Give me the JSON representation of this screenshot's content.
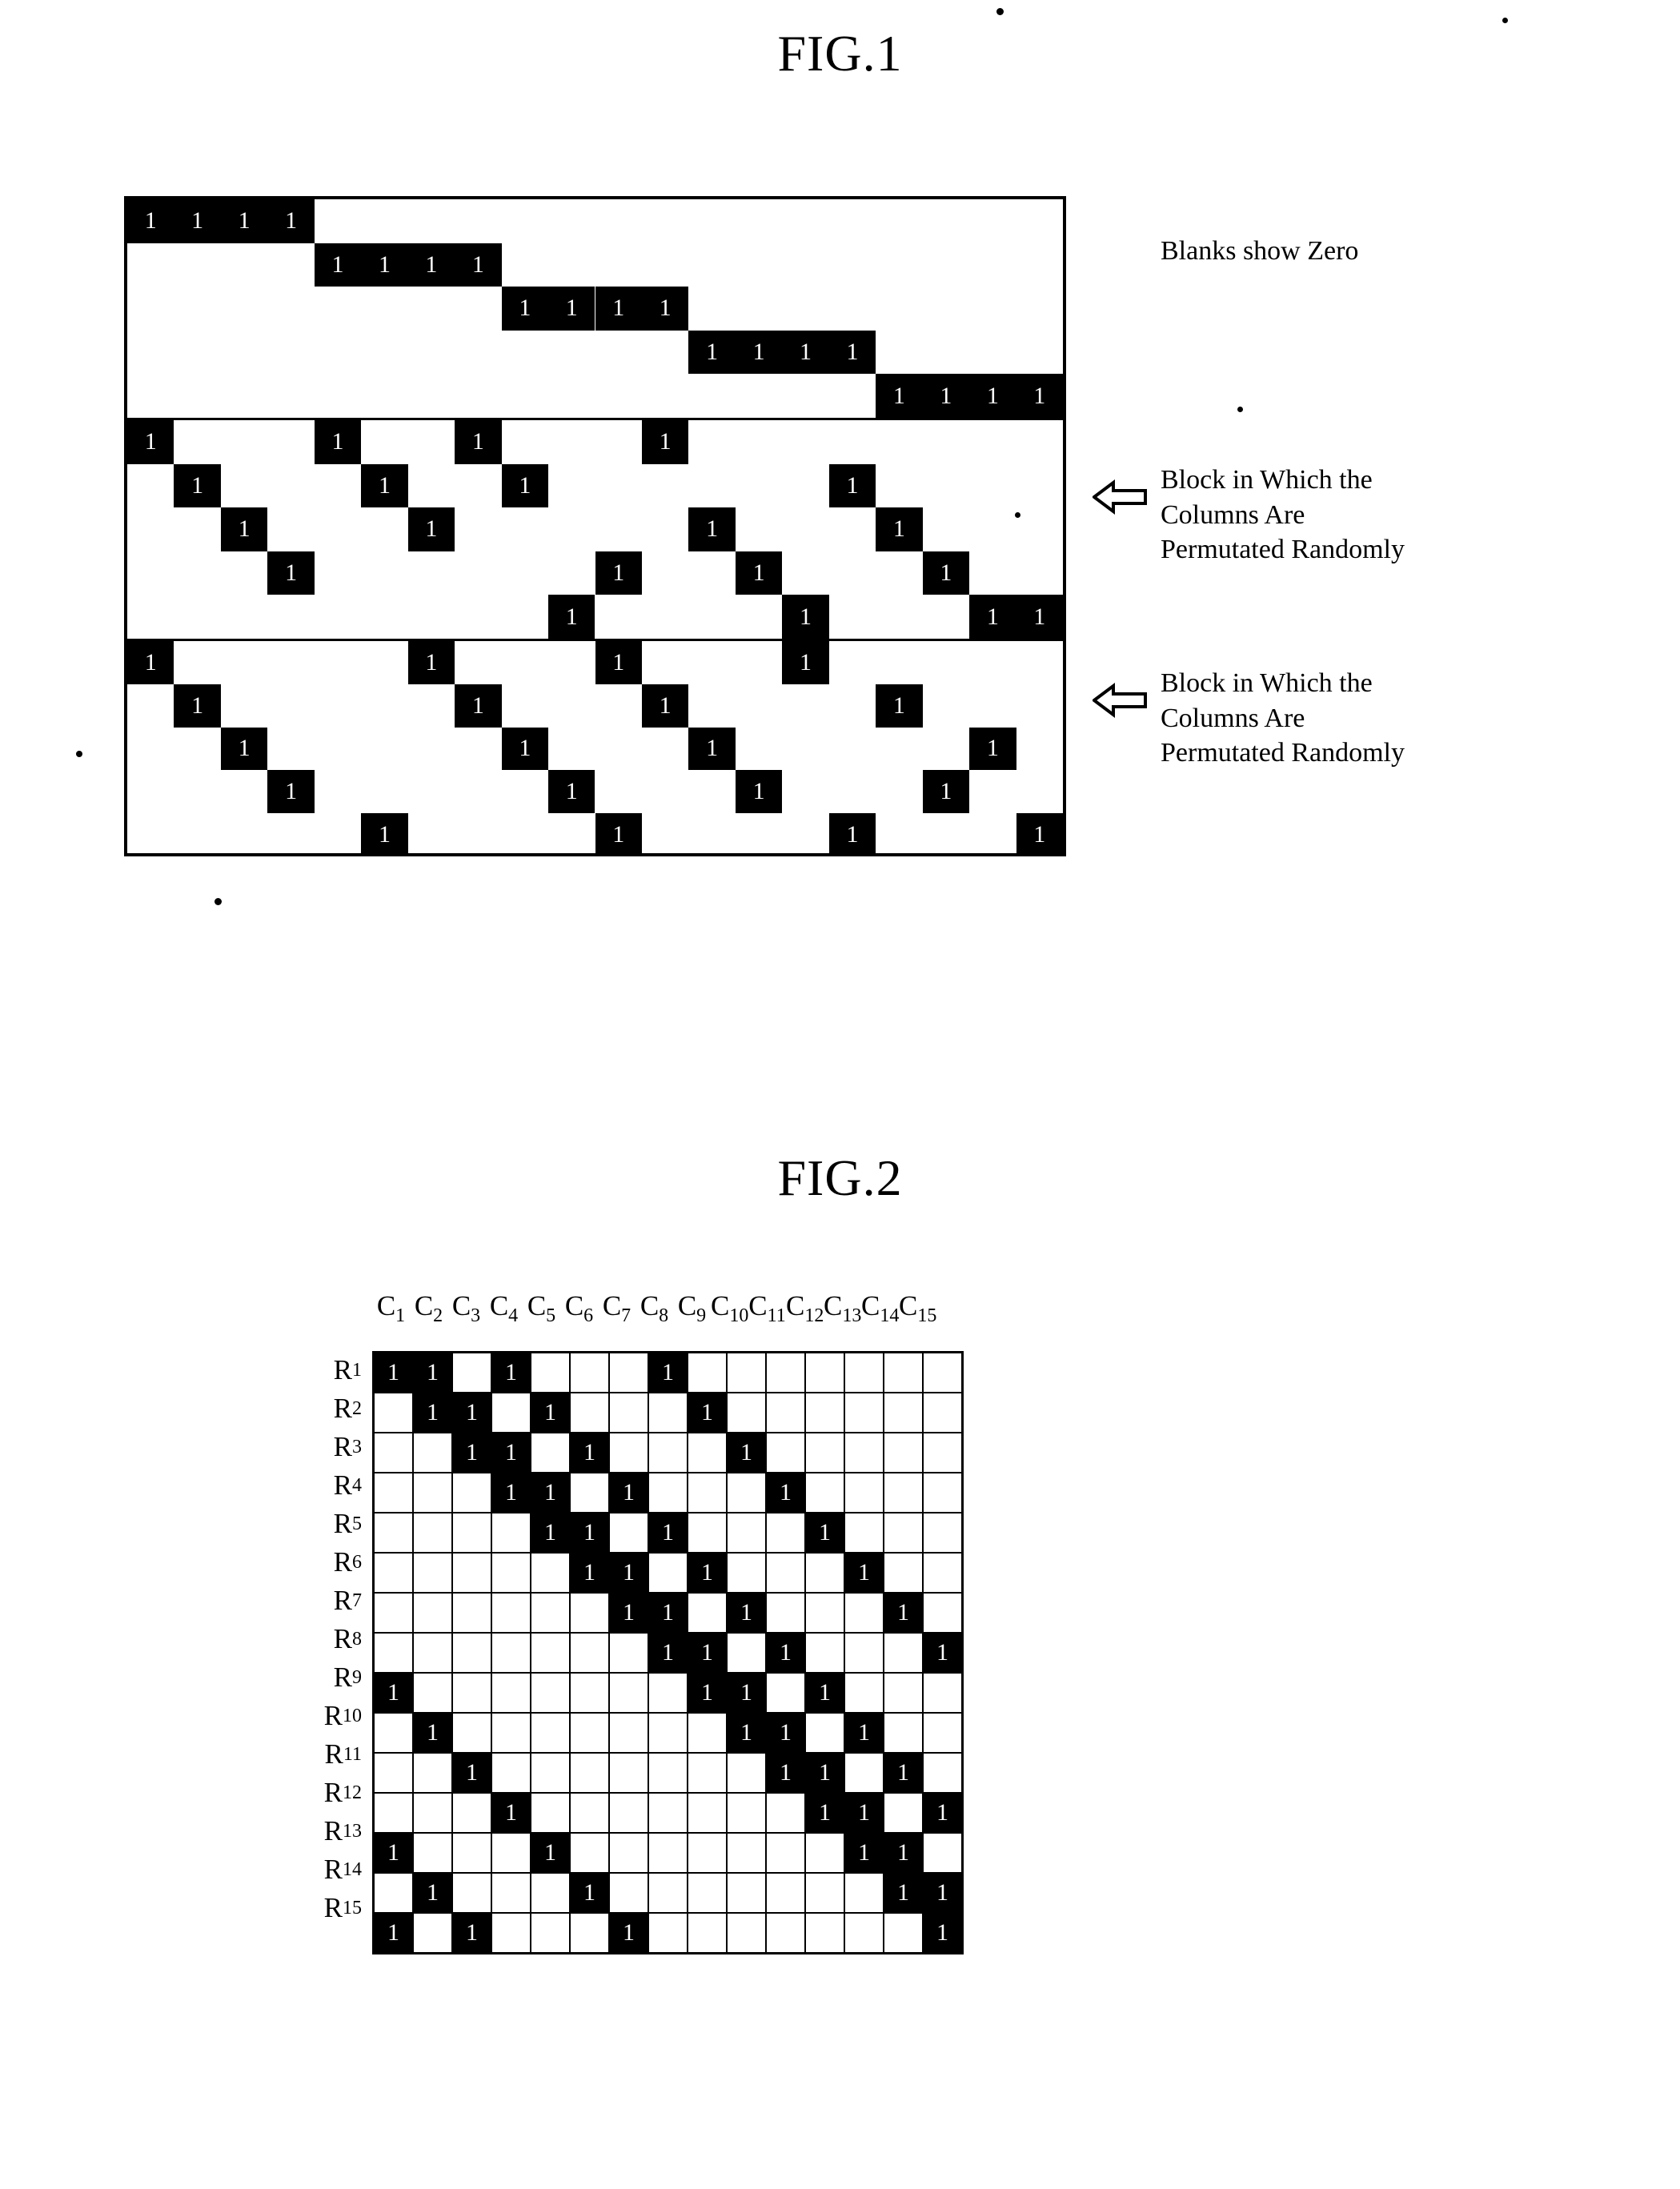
{
  "figures": {
    "fig1_title": "FIG.1",
    "fig2_title": "FIG.2"
  },
  "fig1": {
    "cell_label": "1",
    "notes": {
      "blanks": "Blanks show Zero",
      "middle_block": "Block in Which the\nColumns Are\nPermutated Randomly",
      "bottom_block": "Block in Which the\nColumns Are\nPermutated Randomly"
    },
    "grid": {
      "columns": 20,
      "rows_per_block": 5,
      "blocks": [
        {
          "name": "identity-staircase-block",
          "rows": [
            [
              1,
              2,
              3,
              4
            ],
            [
              5,
              6,
              7,
              8
            ],
            [
              9,
              10,
              11,
              12
            ],
            [
              13,
              14,
              15,
              16
            ],
            [
              17,
              18,
              19,
              20
            ]
          ]
        },
        {
          "name": "permutated-block-1",
          "rows": [
            [
              1,
              5,
              8,
              12
            ],
            [
              2,
              6,
              9,
              16
            ],
            [
              3,
              7,
              13,
              17
            ],
            [
              4,
              11,
              14,
              18
            ],
            [
              10,
              15,
              19,
              20
            ]
          ]
        },
        {
          "name": "permutated-block-2",
          "rows": [
            [
              1,
              7,
              11,
              15
            ],
            [
              2,
              8,
              12,
              17
            ],
            [
              3,
              9,
              13,
              19
            ],
            [
              4,
              10,
              14,
              18
            ],
            [
              6,
              16,
              20,
              11
            ]
          ]
        }
      ]
    }
  },
  "fig2": {
    "cell_label": "1",
    "col_prefix": "C",
    "row_prefix": "R",
    "columns": [
      "1",
      "2",
      "3",
      "4",
      "5",
      "6",
      "7",
      "8",
      "9",
      "10",
      "11",
      "12",
      "13",
      "14",
      "15"
    ],
    "rows": [
      "1",
      "2",
      "3",
      "4",
      "5",
      "6",
      "7",
      "8",
      "9",
      "10",
      "11",
      "12",
      "13",
      "14",
      "15"
    ],
    "matrix": [
      [
        1,
        1,
        0,
        1,
        0,
        0,
        0,
        1,
        0,
        0,
        0,
        0,
        0,
        0,
        0
      ],
      [
        0,
        1,
        1,
        0,
        1,
        0,
        0,
        0,
        1,
        0,
        0,
        0,
        0,
        0,
        0
      ],
      [
        0,
        0,
        1,
        1,
        0,
        1,
        0,
        0,
        0,
        1,
        0,
        0,
        0,
        0,
        0
      ],
      [
        0,
        0,
        0,
        1,
        1,
        0,
        1,
        0,
        0,
        0,
        1,
        0,
        0,
        0,
        0
      ],
      [
        0,
        0,
        0,
        0,
        1,
        1,
        0,
        1,
        0,
        0,
        0,
        1,
        0,
        0,
        0
      ],
      [
        0,
        0,
        0,
        0,
        0,
        1,
        1,
        0,
        1,
        0,
        0,
        0,
        1,
        0,
        0
      ],
      [
        0,
        0,
        0,
        0,
        0,
        0,
        1,
        1,
        0,
        1,
        0,
        0,
        0,
        1,
        0
      ],
      [
        0,
        0,
        0,
        0,
        0,
        0,
        0,
        1,
        1,
        0,
        1,
        0,
        0,
        0,
        1
      ],
      [
        1,
        0,
        0,
        0,
        0,
        0,
        0,
        0,
        1,
        1,
        0,
        1,
        0,
        0,
        0
      ],
      [
        0,
        1,
        0,
        0,
        0,
        0,
        0,
        0,
        0,
        1,
        1,
        0,
        1,
        0,
        0
      ],
      [
        0,
        0,
        1,
        0,
        0,
        0,
        0,
        0,
        0,
        0,
        1,
        1,
        0,
        1,
        0
      ],
      [
        0,
        0,
        0,
        1,
        0,
        0,
        0,
        0,
        0,
        0,
        0,
        1,
        1,
        0,
        1
      ],
      [
        1,
        0,
        0,
        0,
        1,
        0,
        0,
        0,
        0,
        0,
        0,
        0,
        1,
        1,
        0
      ],
      [
        0,
        1,
        0,
        0,
        0,
        1,
        0,
        0,
        0,
        0,
        0,
        0,
        0,
        1,
        1
      ],
      [
        1,
        0,
        1,
        0,
        0,
        0,
        1,
        0,
        0,
        0,
        0,
        0,
        0,
        0,
        1
      ]
    ]
  },
  "colors": {
    "ink": "#000000",
    "paper": "#ffffff"
  }
}
